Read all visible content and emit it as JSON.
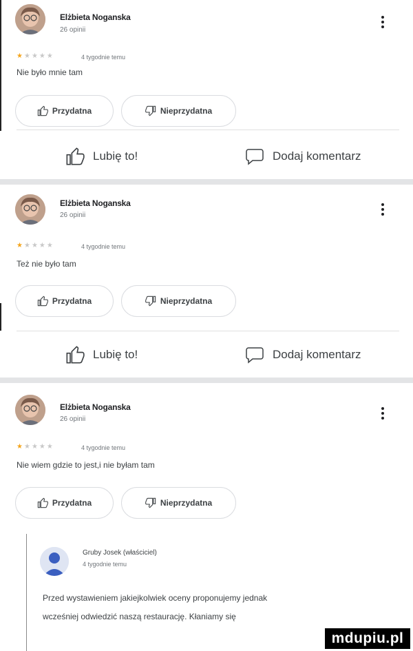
{
  "reviews": [
    {
      "author": "Elżbieta Noganska",
      "meta": "26 opinii",
      "rating": 1,
      "max_rating": 5,
      "time": "4 tygodnie temu",
      "text": "Nie było mnie tam",
      "helpful_label": "Przydatna",
      "not_helpful_label": "Nieprzydatna",
      "like_label": "Lubię to!",
      "comment_label": "Dodaj komentarz"
    },
    {
      "author": "Elżbieta Noganska",
      "meta": "26 opinii",
      "rating": 1,
      "max_rating": 5,
      "time": "4 tygodnie temu",
      "text": "Też nie było tam",
      "helpful_label": "Przydatna",
      "not_helpful_label": "Nieprzydatna",
      "like_label": "Lubię to!",
      "comment_label": "Dodaj komentarz"
    },
    {
      "author": "Elżbieta Noganska",
      "meta": "26 opinii",
      "rating": 1,
      "max_rating": 5,
      "time": "4 tygodnie temu",
      "text": "Nie wiem gdzie to jest,i nie byłam tam",
      "helpful_label": "Przydatna",
      "not_helpful_label": "Nieprzydatna"
    }
  ],
  "owner_reply": {
    "author": "Gruby Josek (właściciel)",
    "time": "4 tygodnie temu",
    "text_line1": "Przed wystawieniem jakiejkolwiek oceny proponujemy jednak",
    "text_line2": "wcześniej odwiedzić naszą restaurację. Kłaniamy się"
  },
  "watermark": "mdupiu.pl",
  "colors": {
    "star_on": "#f4a51c",
    "star_off": "#c8c8c8",
    "separator": "#e3e4e6"
  },
  "icons": [
    "user-avatar-icon",
    "more-vert-icon",
    "star-icon",
    "thumb-up-icon",
    "thumb-down-icon",
    "comment-icon"
  ]
}
